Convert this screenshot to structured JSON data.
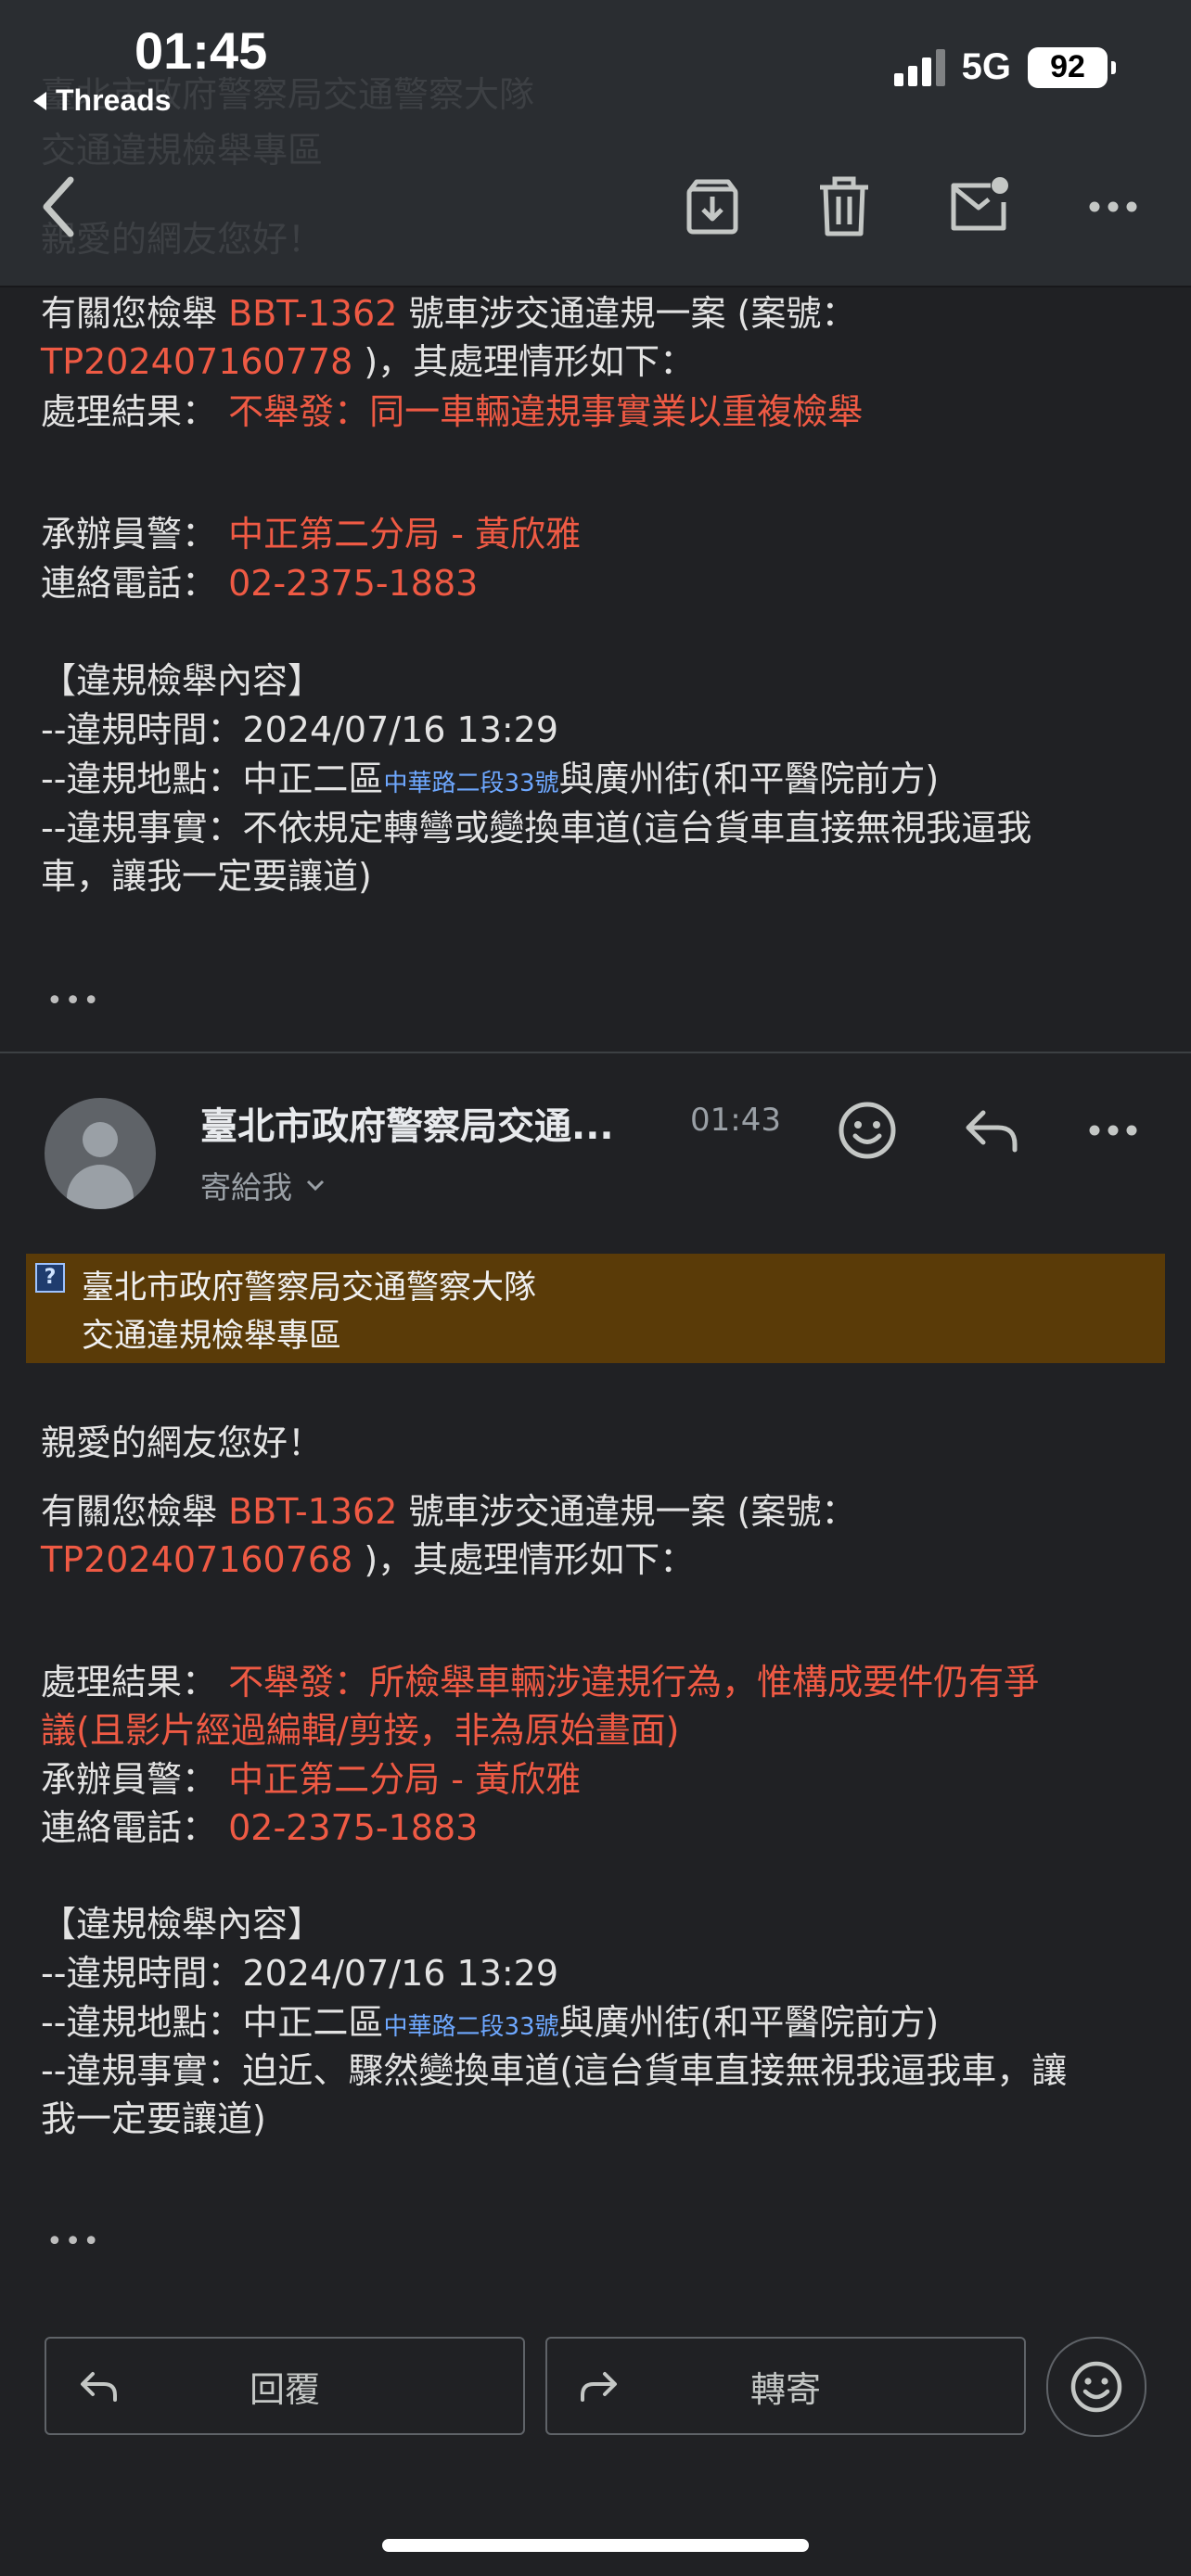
{
  "status_bar": {
    "time": "01:45",
    "back_app": "Threads",
    "network": "5G",
    "battery": "92"
  },
  "ghost": {
    "line1": "臺北市政府警察局交通警察大隊",
    "line2": "交通違規檢舉專區",
    "line3": "親愛的網友您好！"
  },
  "toolbar": {
    "back_icon": "back-arrow-icon",
    "archive_icon": "archive-icon",
    "delete_icon": "trash-icon",
    "unread_icon": "mark-unread-icon",
    "more_icon": "more-horizontal-icon"
  },
  "message1": {
    "l1_pre": "有關您檢舉 ",
    "plate": "BBT-1362",
    "l1_post": " 號車涉交通違規一案 (案號：",
    "case_no": "TP202407160778",
    "l2_post": " )，其處理情形如下：",
    "result_label": "處理結果：",
    "result_value": "不舉發：同一車輛違規事實業以重複檢舉",
    "officer_label": "承辦員警：",
    "officer_value": "中正第二分局 - 黃欣雅",
    "phone_label": "連絡電話：",
    "phone_value": "02-2375-1883",
    "section_title": "【違規檢舉內容】",
    "time_line": "--違規時間：2024/07/16 13:29",
    "place_pre": "--違規地點：中正二區",
    "place_link": "中華路二段33號",
    "place_post": "與廣州街(和平醫院前方)",
    "fact_line1": "--違規事實：不依規定轉彎或變換車道(這台貨車直接無視我逼我",
    "fact_line2": "車，讓我一定要讓道)",
    "ellipsis": "•••"
  },
  "message2": {
    "sender": "臺北市政府警察局交通...",
    "time": "01:43",
    "to_me": "寄給我",
    "banner_line1": "臺北市政府警察局交通警察大隊",
    "banner_line2": "交通違規檢舉專區",
    "greeting": "親愛的網友您好！",
    "l1_pre": "有關您檢舉 ",
    "plate": "BBT-1362",
    "l1_post": " 號車涉交通違規一案 (案號：",
    "case_no": "TP202407160768",
    "l2_post": " )，其處理情形如下：",
    "result_label": "處理結果：",
    "result_value1": "不舉發：所檢舉車輛涉違規行為，惟構成要件仍有爭",
    "result_value2": "議(且影片經過編輯/剪接，非為原始畫面)",
    "officer_label": "承辦員警：",
    "officer_value": "中正第二分局 - 黃欣雅",
    "phone_label": "連絡電話：",
    "phone_value": "02-2375-1883",
    "section_title": "【違規檢舉內容】",
    "time_line": "--違規時間：2024/07/16 13:29",
    "place_pre": "--違規地點：中正二區",
    "place_link": "中華路二段33號",
    "place_post": "與廣州街(和平醫院前方)",
    "fact_line1": "--違規事實：迫近、驟然變換車道(這台貨車直接無視我逼我車，讓",
    "fact_line2": "我一定要讓道)",
    "ellipsis": "•••"
  },
  "actions": {
    "reply": "回覆",
    "forward": "轉寄"
  },
  "colors": {
    "background": "#202124",
    "accent_red": "#ef5a44",
    "banner": "#5a3b08",
    "link": "#6ea8ff"
  }
}
